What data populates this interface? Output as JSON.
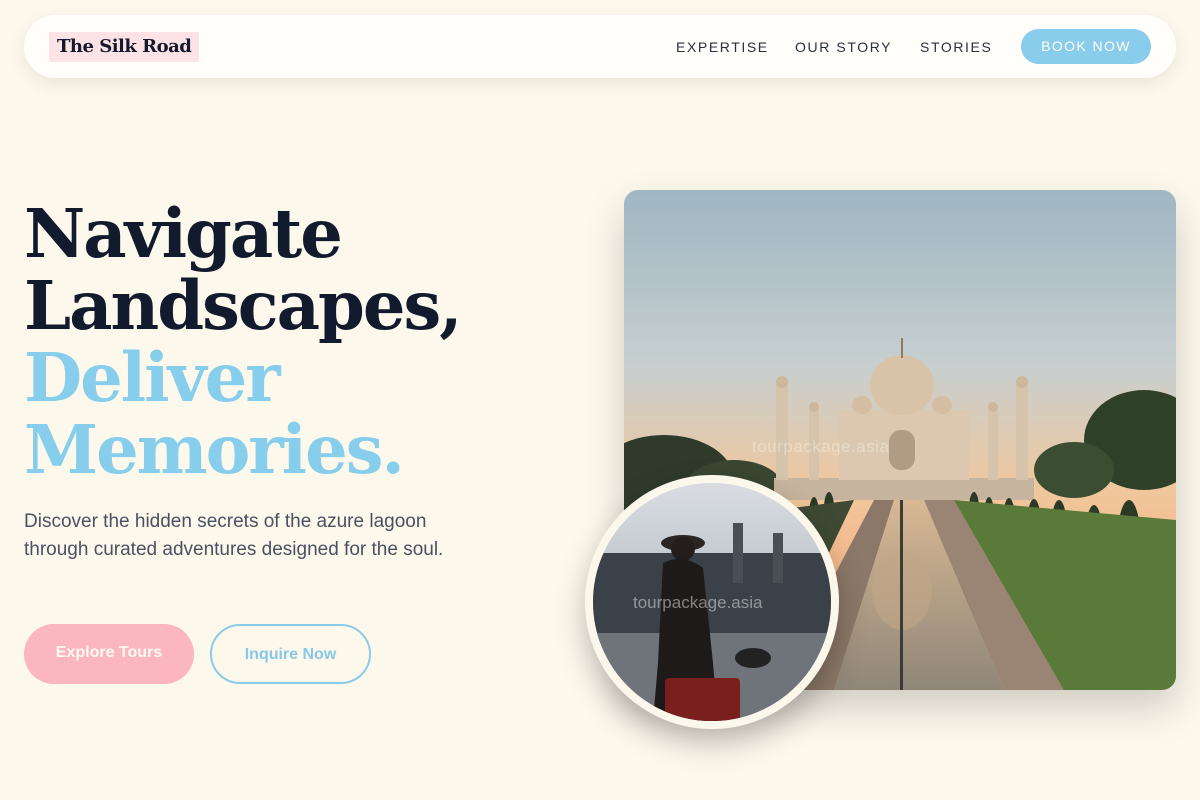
{
  "brand": {
    "logo": "The Silk Road"
  },
  "nav": {
    "links": [
      "EXPERTISE",
      "OUR STORY",
      "STORIES"
    ],
    "cta": "BOOK NOW"
  },
  "hero": {
    "headline_dark": [
      "Navigate",
      "Landscapes,"
    ],
    "headline_accent": [
      "Deliver",
      "Memories."
    ],
    "description": "Discover the hidden secrets of the azure lagoon through curated adventures designed for the soul.",
    "primary_button": "Explore Tours",
    "secondary_button": "Inquire Now"
  },
  "images": {
    "main_watermark": "tourpackage.asia",
    "circle_watermark": "tourpackage.asia"
  },
  "colors": {
    "background": "#fdf8ec",
    "accent_blue": "#87cdec",
    "accent_pink": "#fbb6c0",
    "heading_dark": "#121a2e"
  }
}
